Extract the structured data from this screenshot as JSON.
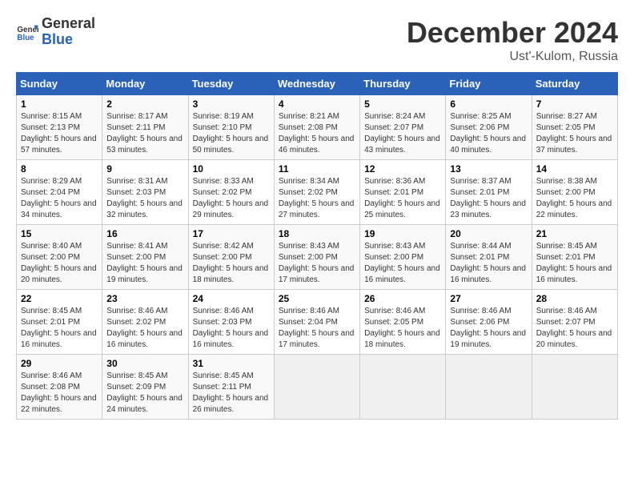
{
  "header": {
    "logo_line1": "General",
    "logo_line2": "Blue",
    "month_year": "December 2024",
    "location": "Ust'-Kulom, Russia"
  },
  "weekdays": [
    "Sunday",
    "Monday",
    "Tuesday",
    "Wednesday",
    "Thursday",
    "Friday",
    "Saturday"
  ],
  "weeks": [
    [
      {
        "day": "1",
        "sunrise": "Sunrise: 8:15 AM",
        "sunset": "Sunset: 2:13 PM",
        "daylight": "Daylight: 5 hours and 57 minutes."
      },
      {
        "day": "2",
        "sunrise": "Sunrise: 8:17 AM",
        "sunset": "Sunset: 2:11 PM",
        "daylight": "Daylight: 5 hours and 53 minutes."
      },
      {
        "day": "3",
        "sunrise": "Sunrise: 8:19 AM",
        "sunset": "Sunset: 2:10 PM",
        "daylight": "Daylight: 5 hours and 50 minutes."
      },
      {
        "day": "4",
        "sunrise": "Sunrise: 8:21 AM",
        "sunset": "Sunset: 2:08 PM",
        "daylight": "Daylight: 5 hours and 46 minutes."
      },
      {
        "day": "5",
        "sunrise": "Sunrise: 8:24 AM",
        "sunset": "Sunset: 2:07 PM",
        "daylight": "Daylight: 5 hours and 43 minutes."
      },
      {
        "day": "6",
        "sunrise": "Sunrise: 8:25 AM",
        "sunset": "Sunset: 2:06 PM",
        "daylight": "Daylight: 5 hours and 40 minutes."
      },
      {
        "day": "7",
        "sunrise": "Sunrise: 8:27 AM",
        "sunset": "Sunset: 2:05 PM",
        "daylight": "Daylight: 5 hours and 37 minutes."
      }
    ],
    [
      {
        "day": "8",
        "sunrise": "Sunrise: 8:29 AM",
        "sunset": "Sunset: 2:04 PM",
        "daylight": "Daylight: 5 hours and 34 minutes."
      },
      {
        "day": "9",
        "sunrise": "Sunrise: 8:31 AM",
        "sunset": "Sunset: 2:03 PM",
        "daylight": "Daylight: 5 hours and 32 minutes."
      },
      {
        "day": "10",
        "sunrise": "Sunrise: 8:33 AM",
        "sunset": "Sunset: 2:02 PM",
        "daylight": "Daylight: 5 hours and 29 minutes."
      },
      {
        "day": "11",
        "sunrise": "Sunrise: 8:34 AM",
        "sunset": "Sunset: 2:02 PM",
        "daylight": "Daylight: 5 hours and 27 minutes."
      },
      {
        "day": "12",
        "sunrise": "Sunrise: 8:36 AM",
        "sunset": "Sunset: 2:01 PM",
        "daylight": "Daylight: 5 hours and 25 minutes."
      },
      {
        "day": "13",
        "sunrise": "Sunrise: 8:37 AM",
        "sunset": "Sunset: 2:01 PM",
        "daylight": "Daylight: 5 hours and 23 minutes."
      },
      {
        "day": "14",
        "sunrise": "Sunrise: 8:38 AM",
        "sunset": "Sunset: 2:00 PM",
        "daylight": "Daylight: 5 hours and 22 minutes."
      }
    ],
    [
      {
        "day": "15",
        "sunrise": "Sunrise: 8:40 AM",
        "sunset": "Sunset: 2:00 PM",
        "daylight": "Daylight: 5 hours and 20 minutes."
      },
      {
        "day": "16",
        "sunrise": "Sunrise: 8:41 AM",
        "sunset": "Sunset: 2:00 PM",
        "daylight": "Daylight: 5 hours and 19 minutes."
      },
      {
        "day": "17",
        "sunrise": "Sunrise: 8:42 AM",
        "sunset": "Sunset: 2:00 PM",
        "daylight": "Daylight: 5 hours and 18 minutes."
      },
      {
        "day": "18",
        "sunrise": "Sunrise: 8:43 AM",
        "sunset": "Sunset: 2:00 PM",
        "daylight": "Daylight: 5 hours and 17 minutes."
      },
      {
        "day": "19",
        "sunrise": "Sunrise: 8:43 AM",
        "sunset": "Sunset: 2:00 PM",
        "daylight": "Daylight: 5 hours and 16 minutes."
      },
      {
        "day": "20",
        "sunrise": "Sunrise: 8:44 AM",
        "sunset": "Sunset: 2:01 PM",
        "daylight": "Daylight: 5 hours and 16 minutes."
      },
      {
        "day": "21",
        "sunrise": "Sunrise: 8:45 AM",
        "sunset": "Sunset: 2:01 PM",
        "daylight": "Daylight: 5 hours and 16 minutes."
      }
    ],
    [
      {
        "day": "22",
        "sunrise": "Sunrise: 8:45 AM",
        "sunset": "Sunset: 2:01 PM",
        "daylight": "Daylight: 5 hours and 16 minutes."
      },
      {
        "day": "23",
        "sunrise": "Sunrise: 8:46 AM",
        "sunset": "Sunset: 2:02 PM",
        "daylight": "Daylight: 5 hours and 16 minutes."
      },
      {
        "day": "24",
        "sunrise": "Sunrise: 8:46 AM",
        "sunset": "Sunset: 2:03 PM",
        "daylight": "Daylight: 5 hours and 16 minutes."
      },
      {
        "day": "25",
        "sunrise": "Sunrise: 8:46 AM",
        "sunset": "Sunset: 2:04 PM",
        "daylight": "Daylight: 5 hours and 17 minutes."
      },
      {
        "day": "26",
        "sunrise": "Sunrise: 8:46 AM",
        "sunset": "Sunset: 2:05 PM",
        "daylight": "Daylight: 5 hours and 18 minutes."
      },
      {
        "day": "27",
        "sunrise": "Sunrise: 8:46 AM",
        "sunset": "Sunset: 2:06 PM",
        "daylight": "Daylight: 5 hours and 19 minutes."
      },
      {
        "day": "28",
        "sunrise": "Sunrise: 8:46 AM",
        "sunset": "Sunset: 2:07 PM",
        "daylight": "Daylight: 5 hours and 20 minutes."
      }
    ],
    [
      {
        "day": "29",
        "sunrise": "Sunrise: 8:46 AM",
        "sunset": "Sunset: 2:08 PM",
        "daylight": "Daylight: 5 hours and 22 minutes."
      },
      {
        "day": "30",
        "sunrise": "Sunrise: 8:45 AM",
        "sunset": "Sunset: 2:09 PM",
        "daylight": "Daylight: 5 hours and 24 minutes."
      },
      {
        "day": "31",
        "sunrise": "Sunrise: 8:45 AM",
        "sunset": "Sunset: 2:11 PM",
        "daylight": "Daylight: 5 hours and 26 minutes."
      },
      null,
      null,
      null,
      null
    ]
  ]
}
